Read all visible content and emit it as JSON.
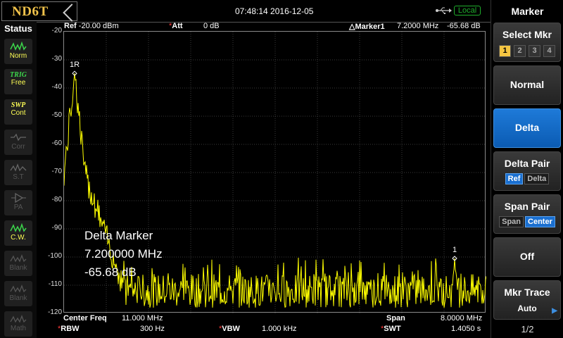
{
  "header": {
    "logo": "ND6T",
    "datetime": "07:48:14 2016-12-05",
    "remote_status": "Local"
  },
  "status_panel": {
    "title": "Status",
    "items": [
      {
        "top": "",
        "label": "Norm",
        "icon": "waveform-icon",
        "state": "on"
      },
      {
        "top": "TRIG",
        "label": "Free",
        "icon": "",
        "state": "on"
      },
      {
        "top": "SWP",
        "label": "Cont",
        "icon": "",
        "state": "on2"
      },
      {
        "top": "",
        "label": "Corr",
        "icon": "correction-icon",
        "state": "off"
      },
      {
        "top": "",
        "label": "S.T",
        "icon": "sweep-time-icon",
        "state": "off"
      },
      {
        "top": "",
        "label": "PA",
        "icon": "preamp-icon",
        "state": "off"
      },
      {
        "top": "",
        "label": "C.W.",
        "icon": "waveform-icon",
        "state": "on"
      },
      {
        "top": "",
        "label": "Blank",
        "icon": "trace-icon",
        "state": "off"
      },
      {
        "top": "",
        "label": "Blank",
        "icon": "trace-icon",
        "state": "off"
      },
      {
        "top": "",
        "label": "Math",
        "icon": "trace-icon",
        "state": "off"
      }
    ]
  },
  "graph_header": {
    "ref_label": "Ref",
    "ref_value": "-20.00 dBm",
    "att_label": "Att",
    "att_value": "0 dB",
    "marker_label": "Marker1",
    "marker_freq": "7.2000 MHz",
    "marker_level": "-65.68 dB"
  },
  "marker_readout": {
    "title": "Delta Marker",
    "freq": "7.200000 MHz",
    "level": "-65.68 dB"
  },
  "marker_tags": {
    "reference": "1R",
    "delta": "1"
  },
  "bottom_info": {
    "center_label": "Center Freq",
    "center_value": "11.000 MHz",
    "span_label": "Span",
    "span_value": "8.0000 MHz",
    "rbw_label": "RBW",
    "rbw_value": "300 Hz",
    "vbw_label": "VBW",
    "vbw_value": "1.000 kHz",
    "swt_label": "SWT",
    "swt_value": "1.4050 s"
  },
  "right_panel": {
    "title": "Marker",
    "select_mkr": {
      "label": "Select Mkr",
      "options": [
        "1",
        "2",
        "3",
        "4"
      ],
      "selected": "1"
    },
    "normal": "Normal",
    "delta": "Delta",
    "delta_pair": {
      "label": "Delta Pair",
      "options": [
        "Ref",
        "Delta"
      ],
      "selected": "Ref"
    },
    "span_pair": {
      "label": "Span Pair",
      "options": [
        "Span",
        "Center"
      ],
      "selected": "Center"
    },
    "off": "Off",
    "mkr_trace": {
      "label": "Mkr Trace",
      "value": "Auto"
    },
    "page": "1/2"
  },
  "colors": {
    "trace": "#ffff00",
    "accent": "#1e7ad8",
    "logo": "#f0c24a",
    "status_ok": "#1fae2c"
  },
  "chart_data": {
    "type": "line",
    "title": "",
    "xlabel": "",
    "ylabel": "",
    "ylim": [
      -120,
      -20
    ],
    "y_unit": "dBm",
    "yticks": [
      -20,
      -30,
      -40,
      -50,
      -60,
      -70,
      -80,
      -90,
      -100,
      -110,
      -120
    ],
    "x_range_mhz": [
      7.0,
      15.0
    ],
    "grid": true,
    "series": [
      {
        "color": "#ffff00",
        "peaks": [
          {
            "x": 7.2,
            "y": -34.8
          },
          {
            "x": 14.4,
            "y": -100.5
          }
        ],
        "noise_floor": -112
      }
    ],
    "markers": [
      {
        "label": "1R",
        "x": 7.2,
        "y": -34.8
      },
      {
        "label": "1",
        "x": 14.4,
        "y": -100.5
      }
    ]
  }
}
